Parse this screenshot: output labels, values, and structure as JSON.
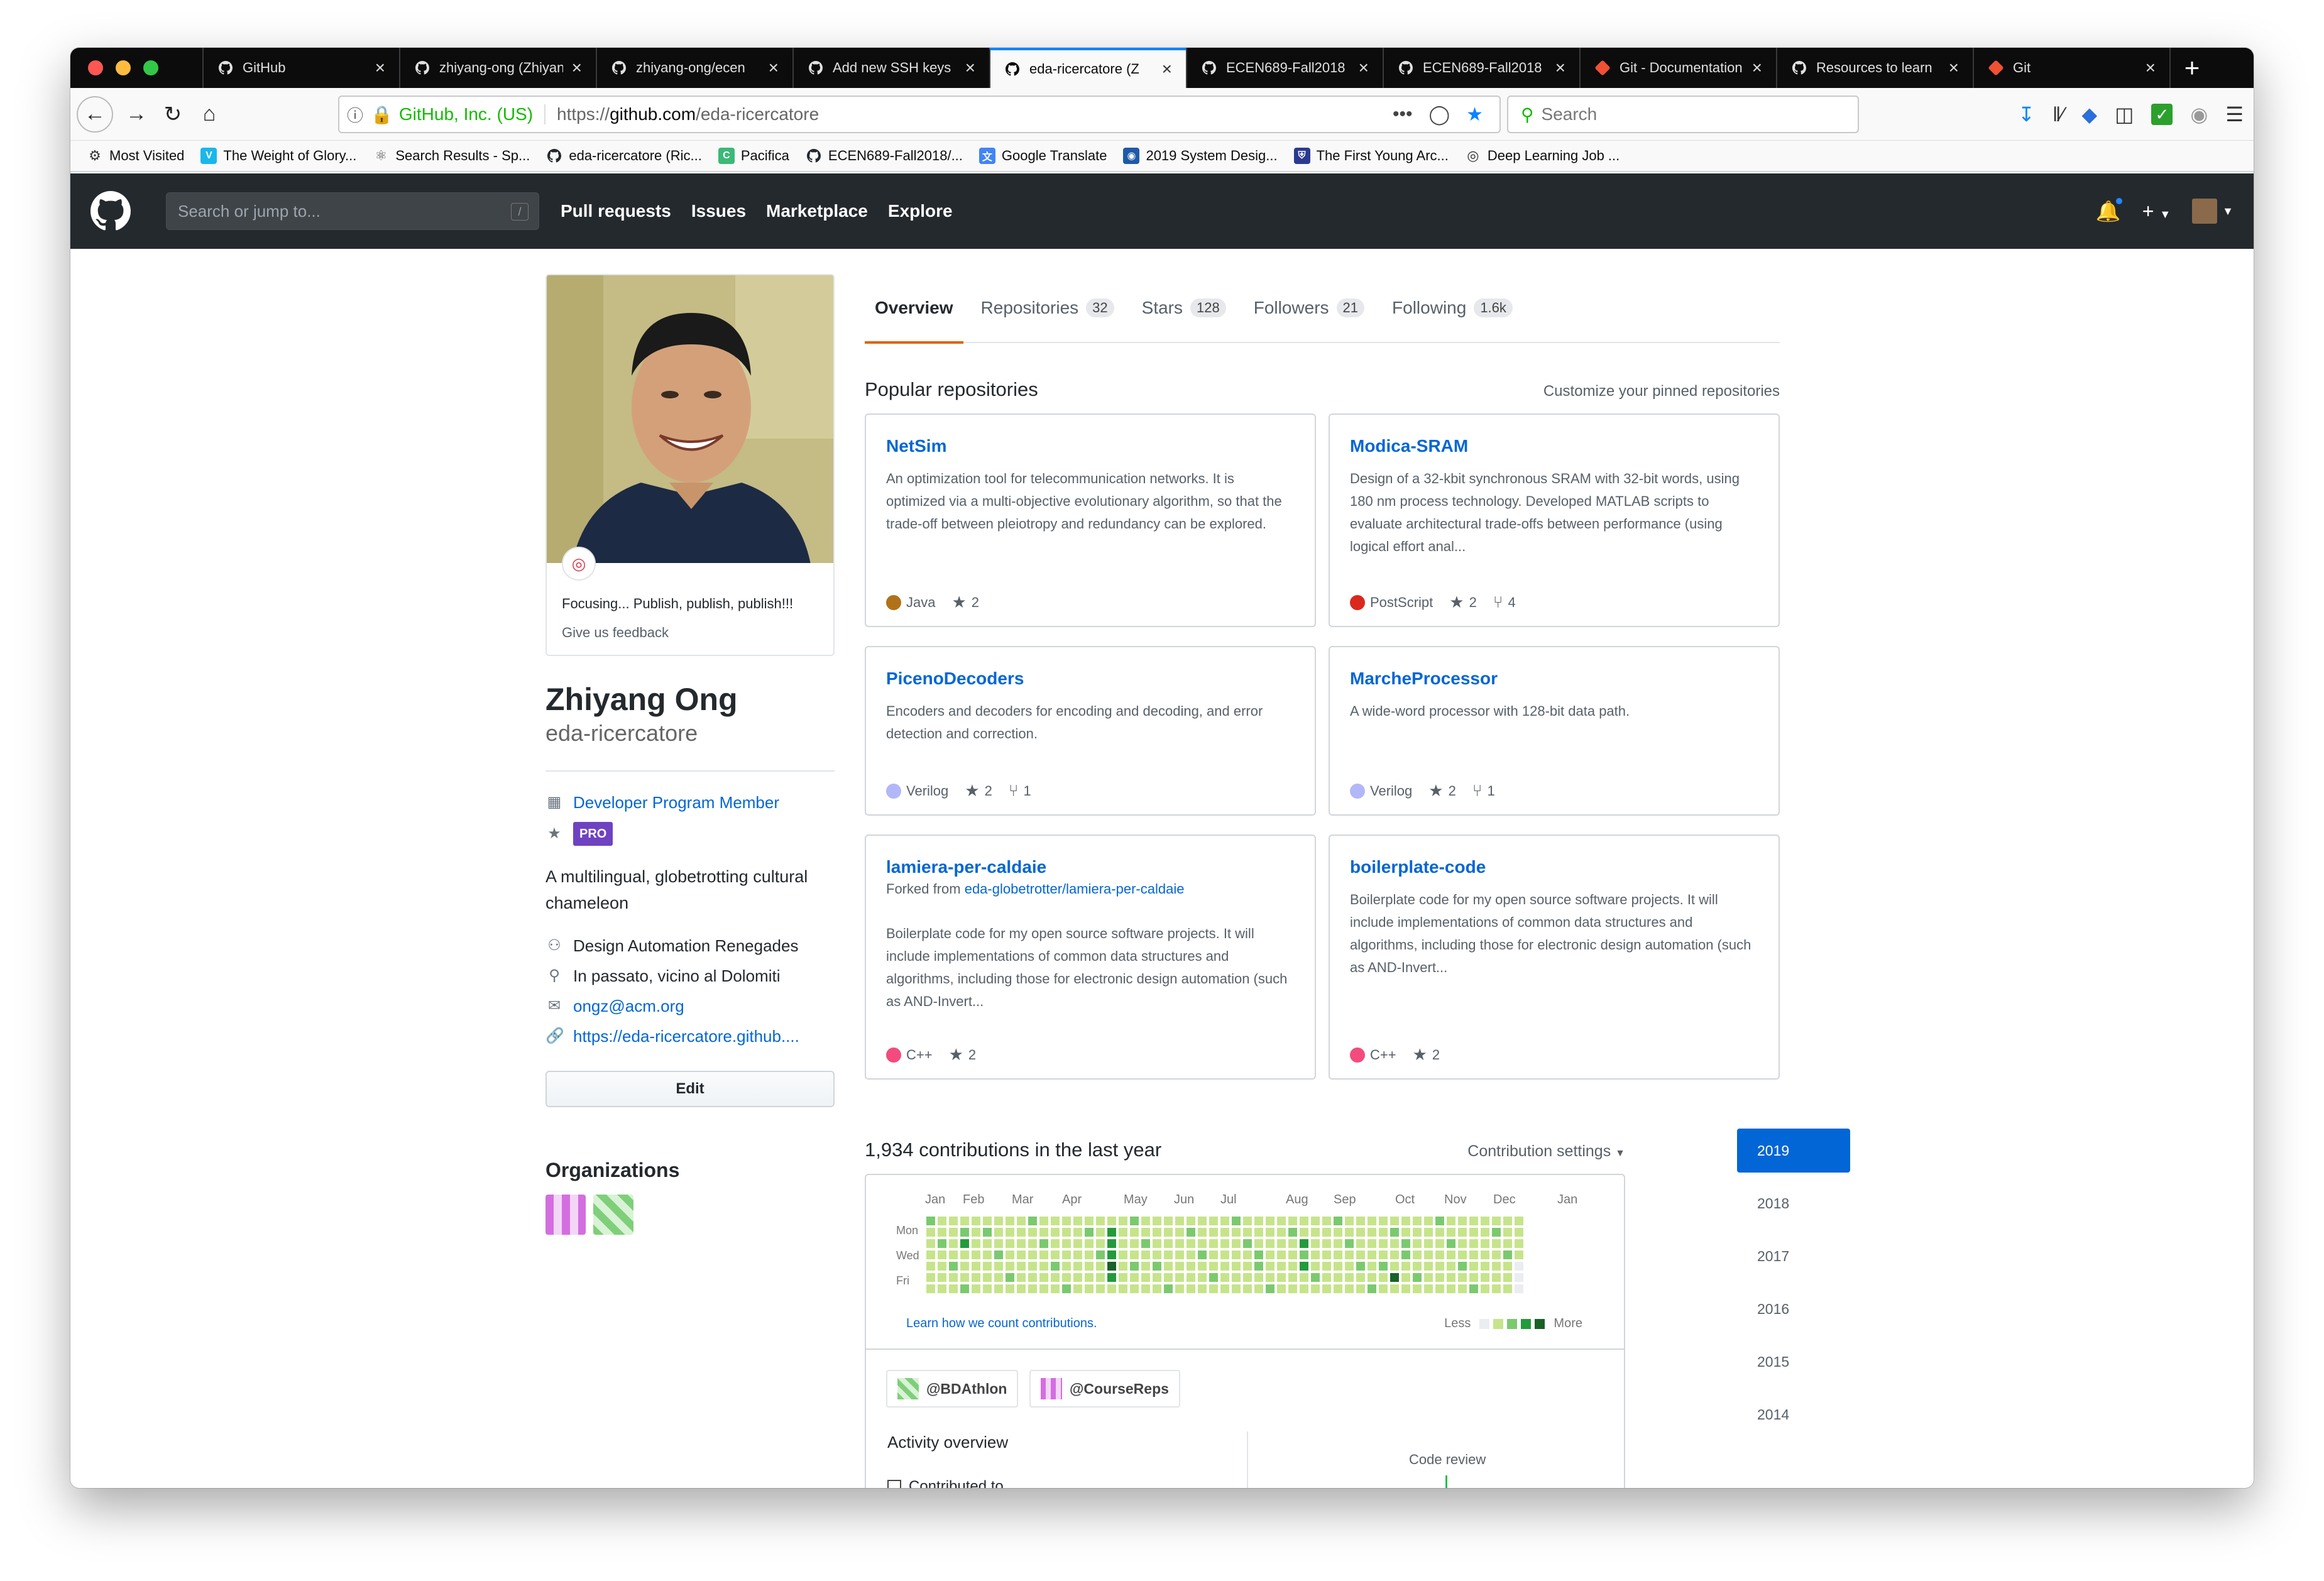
{
  "browser": {
    "tabs": [
      {
        "title": "GitHub",
        "icon": "github-icon",
        "active": false
      },
      {
        "title": "zhiyang-ong (Zhiyang",
        "icon": "github-icon",
        "active": false
      },
      {
        "title": "zhiyang-ong/ecen",
        "icon": "github-icon",
        "active": false
      },
      {
        "title": "Add new SSH keys",
        "icon": "github-icon",
        "active": false
      },
      {
        "title": "eda-ricercatore (Z",
        "icon": "github-icon",
        "active": true
      },
      {
        "title": "ECEN689-Fall2018",
        "icon": "github-icon",
        "active": false
      },
      {
        "title": "ECEN689-Fall2018",
        "icon": "github-icon",
        "active": false
      },
      {
        "title": "Git - Documentation",
        "icon": "git-icon",
        "active": false
      },
      {
        "title": "Resources to learn",
        "icon": "github-icon",
        "active": false
      },
      {
        "title": "Git",
        "icon": "git-icon",
        "active": false
      }
    ],
    "url_org": "GitHub, Inc. (US)",
    "url_prefix": "https://",
    "url_host": "github.com",
    "url_path": "/eda-ricercatore",
    "search_placeholder": "Search",
    "bookmarks": [
      {
        "label": "Most Visited",
        "icon": "gear-icon",
        "color": "#333333"
      },
      {
        "label": "The Weight of Glory...",
        "icon": "vimeo-icon",
        "color": "#1ab7ea"
      },
      {
        "label": "Search Results - Sp...",
        "icon": "springer-icon",
        "color": "#555555"
      },
      {
        "label": "eda-ricercatore (Ric...",
        "icon": "github-icon",
        "color": "#24292e"
      },
      {
        "label": "Pacifica",
        "icon": "pacifica-icon",
        "color": "#3cb878"
      },
      {
        "label": "ECEN689-Fall2018/...",
        "icon": "github-icon",
        "color": "#24292e"
      },
      {
        "label": "Google Translate",
        "icon": "translate-icon",
        "color": "#4285f4"
      },
      {
        "label": "2019 System Desig...",
        "icon": "dac-icon",
        "color": "#1e5aa8"
      },
      {
        "label": "The First Young Arc...",
        "icon": "shield-icon",
        "color": "#2a3b8f"
      },
      {
        "label": "Deep Learning Job ...",
        "icon": "globe-icon",
        "color": "#333333"
      }
    ]
  },
  "github": {
    "search_placeholder": "Search or jump to...",
    "search_kbd": "/",
    "nav": [
      "Pull requests",
      "Issues",
      "Marketplace",
      "Explore"
    ]
  },
  "profile": {
    "status": "Focusing... Publish, publish, publish!!!",
    "feedback": "Give us feedback",
    "name": "Zhiyang Ong",
    "login": "eda-ricercatore",
    "developer_program": "Developer Program Member",
    "pro_badge": "PRO",
    "bio": "A multilingual, globetrotting cultural chameleon",
    "company": "Design Automation Renegades",
    "location": "In passato, vicino al Dolomiti",
    "email": "ongz@acm.org",
    "website": "https://eda-ricercatore.github....",
    "edit_label": "Edit",
    "organizations_title": "Organizations"
  },
  "tabs": [
    {
      "label": "Overview",
      "count": ""
    },
    {
      "label": "Repositories",
      "count": "32"
    },
    {
      "label": "Stars",
      "count": "128"
    },
    {
      "label": "Followers",
      "count": "21"
    },
    {
      "label": "Following",
      "count": "1.6k"
    }
  ],
  "popular": {
    "title": "Popular repositories",
    "customize": "Customize your pinned repositories",
    "repos": [
      {
        "name": "NetSim",
        "fork": "",
        "desc": "An optimization tool for telecommunication networks. It is optimized via a multi-objective evolutionary algorithm, so that the trade-off between pleiotropy and redundancy can be explored.",
        "lang": "Java",
        "color": "#b07219",
        "stars": "2",
        "forks": ""
      },
      {
        "name": "Modica-SRAM",
        "fork": "",
        "desc": "Design of a 32-kbit synchronous SRAM with 32-bit words, using 180 nm process technology. Developed MATLAB scripts to evaluate architectural trade-offs between performance (using logical effort anal...",
        "lang": "PostScript",
        "color": "#da291c",
        "stars": "2",
        "forks": "4"
      },
      {
        "name": "PicenoDecoders",
        "fork": "",
        "desc": "Encoders and decoders for encoding and decoding, and error detection and correction.",
        "lang": "Verilog",
        "color": "#b2b7f8",
        "stars": "2",
        "forks": "1"
      },
      {
        "name": "MarcheProcessor",
        "fork": "",
        "desc": "A wide-word processor with 128-bit data path.",
        "lang": "Verilog",
        "color": "#b2b7f8",
        "stars": "2",
        "forks": "1"
      },
      {
        "name": "lamiera-per-caldaie",
        "fork_prefix": "Forked from ",
        "fork": "eda-globetrotter/lamiera-per-caldaie",
        "desc": "Boilerplate code for my open source software projects. It will include implementations of common data structures and algorithms, including those for electronic design automation (such as AND-Invert...",
        "lang": "C++",
        "color": "#f34b7d",
        "stars": "2",
        "forks": ""
      },
      {
        "name": "boilerplate-code",
        "fork": "",
        "desc": "Boilerplate code for my open source software projects. It will include implementations of common data structures and algorithms, including those for electronic design automation (such as AND-Invert...",
        "lang": "C++",
        "color": "#f34b7d",
        "stars": "2",
        "forks": ""
      }
    ]
  },
  "contributions": {
    "title": "1,934 contributions in the last year",
    "settings": "Contribution settings",
    "months": [
      "Jan",
      "Feb",
      "Mar",
      "Apr",
      "May",
      "Jun",
      "Jul",
      "Aug",
      "Sep",
      "Oct",
      "Nov",
      "Dec",
      "Jan"
    ],
    "days": [
      "Mon",
      "Wed",
      "Fri"
    ],
    "learn": "Learn how we count contributions.",
    "less": "Less",
    "more": "More",
    "colors": [
      "#ebedf0",
      "#c6e48b",
      "#7bc96f",
      "#239a3b",
      "#196127"
    ]
  },
  "activity": {
    "orgs": [
      "@BDAthlon",
      "@CourseReps"
    ],
    "overview_title": "Activity overview",
    "contributed_to": "Contributed to",
    "code_review": "Code review"
  },
  "years": [
    "2019",
    "2018",
    "2017",
    "2016",
    "2015",
    "2014"
  ]
}
